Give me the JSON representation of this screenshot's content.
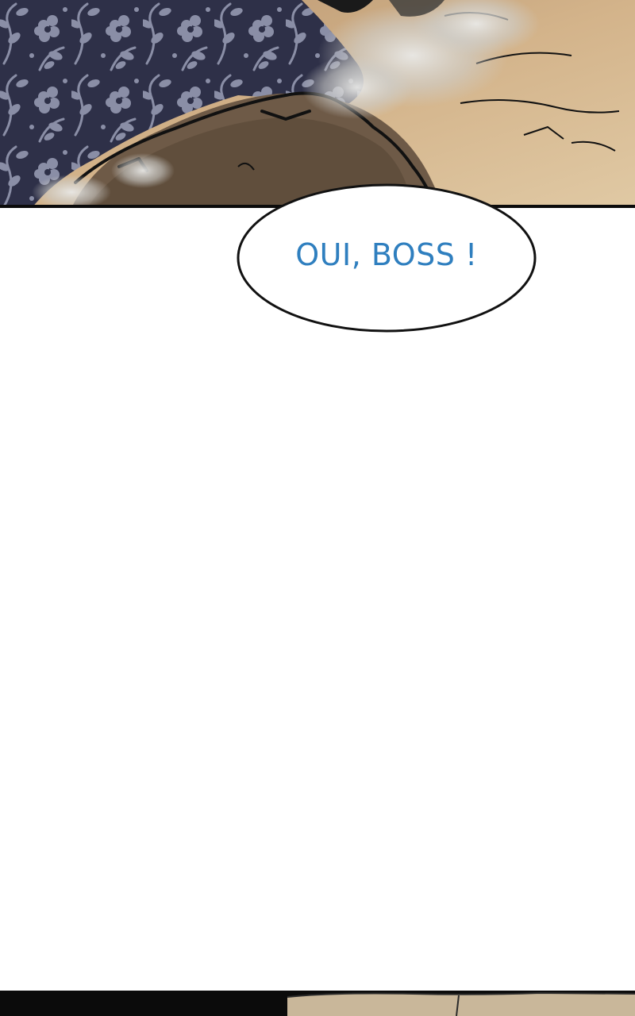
{
  "comic": {
    "speech_bubble": {
      "text": "OUI, BOSS !"
    }
  },
  "colors": {
    "dialogue_text": "#2f7fbf",
    "panel_border": "#0b0b0b",
    "fabric_dark": "#2e3048",
    "fabric_pattern": "#8a8ea6",
    "skin": "#6e5a47",
    "ground_tan": "#c9a77e",
    "smoke": "#d8d8d6"
  }
}
